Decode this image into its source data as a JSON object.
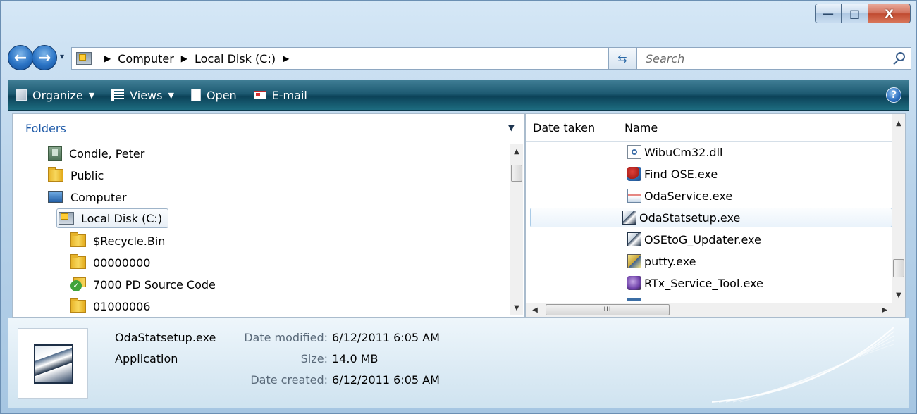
{
  "window": {
    "minimize_glyph": "—",
    "maximize_glyph": "□",
    "close_glyph": "X"
  },
  "address": {
    "segments": [
      "Computer",
      "Local Disk (C:)"
    ],
    "separator": "▶",
    "dropdown_glyph": "▾"
  },
  "search": {
    "placeholder": "Search"
  },
  "toolbar": {
    "organize": "Organize",
    "views": "Views",
    "open": "Open",
    "email": "E-mail",
    "help": "?"
  },
  "folders": {
    "header": "Folders",
    "items": [
      {
        "label": "Condie, Peter",
        "icon": "user-folder-icon"
      },
      {
        "label": "Public",
        "icon": "folder-icon"
      },
      {
        "label": "Computer",
        "icon": "computer-icon"
      },
      {
        "label": "Local Disk (C:)",
        "icon": "disk-icon",
        "selected": true
      },
      {
        "label": "$Recycle.Bin",
        "icon": "folder-icon"
      },
      {
        "label": "00000000",
        "icon": "folder-icon"
      },
      {
        "label": "7000 PD Source Code",
        "icon": "sync-folder-icon"
      },
      {
        "label": "01000006",
        "icon": "folder-icon"
      }
    ]
  },
  "files": {
    "columns": [
      "Date taken",
      "Name"
    ],
    "items": [
      {
        "name": "WibuCm32.dll",
        "icon": "dll-icon"
      },
      {
        "name": "Find OSE.exe",
        "icon": "find-ose-icon"
      },
      {
        "name": "OdaService.exe",
        "icon": "oda-service-icon"
      },
      {
        "name": "OdaStatsetup.exe",
        "icon": "oda-setup-icon",
        "selected": true
      },
      {
        "name": "OSEtoG_Updater.exe",
        "icon": "oda-setup-icon"
      },
      {
        "name": "putty.exe",
        "icon": "putty-icon"
      },
      {
        "name": "RTx_Service_Tool.exe",
        "icon": "rtx-icon"
      }
    ],
    "hscroll_grip": "III"
  },
  "details": {
    "filename": "OdaStatsetup.exe",
    "type": "Application",
    "date_modified_label": "Date modified:",
    "date_modified": "6/12/2011 6:05 AM",
    "size_label": "Size:",
    "size": "14.0 MB",
    "date_created_label": "Date created:",
    "date_created": "6/12/2011 6:05 AM"
  }
}
